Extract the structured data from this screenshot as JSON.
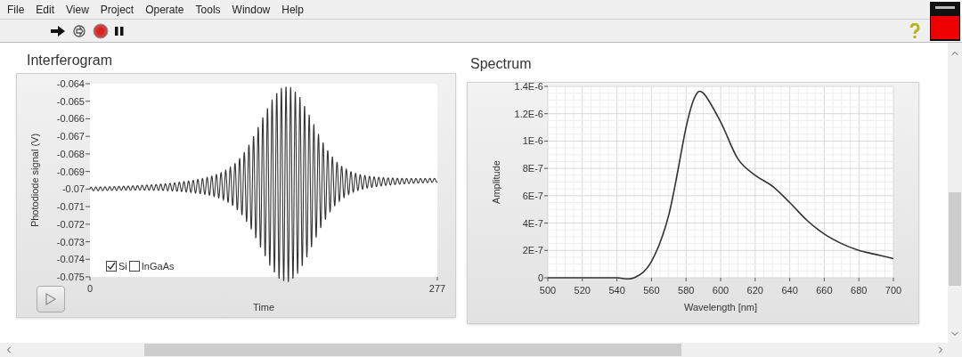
{
  "menu": [
    "File",
    "Edit",
    "View",
    "Project",
    "Operate",
    "Tools",
    "Window",
    "Help"
  ],
  "interferogram": {
    "title": "Interferogram",
    "y_axis_label": "Photodiode signal (V)",
    "y_ticks": [
      "-0.064",
      "-0.065",
      "-0.066",
      "-0.067",
      "-0.068",
      "-0.069",
      "-0.07",
      "-0.071",
      "-0.072",
      "-0.073",
      "-0.074",
      "-0.075"
    ],
    "x_ticks": [
      "0",
      "277"
    ],
    "x_axis_label": "Time",
    "legend": [
      {
        "label": "Si",
        "checked": true
      },
      {
        "label": "InGaAs",
        "checked": false
      }
    ]
  },
  "spectrum": {
    "chart_data": {
      "type": "line",
      "title": "Spectrum",
      "xlabel": "Wavelength [nm]",
      "ylabel": "Amplitude",
      "x": [
        500,
        510,
        520,
        530,
        540,
        550,
        560,
        570,
        580,
        585,
        590,
        600,
        610,
        620,
        630,
        640,
        650,
        660,
        670,
        680,
        690,
        700
      ],
      "grid": true,
      "series": [
        {
          "color": "#333333",
          "values": [
            0,
            0,
            0,
            0,
            0,
            0,
            1.2e-07,
            4.6e-07,
            1.1e-06,
            1.32e-06,
            1.35e-06,
            1.14e-06,
            8.7e-07,
            7.5e-07,
            6.7e-07,
            5.5e-07,
            4.2e-07,
            3.2e-07,
            2.5e-07,
            2e-07,
            1.7e-07,
            1.4e-07
          ]
        }
      ],
      "xlim": [
        500,
        700
      ],
      "ylim": [
        0,
        1.4e-06
      ],
      "xticks": [
        500,
        520,
        540,
        560,
        580,
        600,
        620,
        640,
        660,
        680,
        700
      ],
      "yticks": [
        {
          "value": 0,
          "label": "0"
        },
        {
          "value": 2e-07,
          "label": "2E-7"
        },
        {
          "value": 4e-07,
          "label": "4E-7"
        },
        {
          "value": 6e-07,
          "label": "6E-7"
        },
        {
          "value": 8e-07,
          "label": "8E-7"
        },
        {
          "value": 1e-06,
          "label": "1E-6"
        },
        {
          "value": 1.2e-06,
          "label": "1.2E-6"
        },
        {
          "value": 1.4e-06,
          "label": "1.4E-6"
        }
      ]
    }
  }
}
